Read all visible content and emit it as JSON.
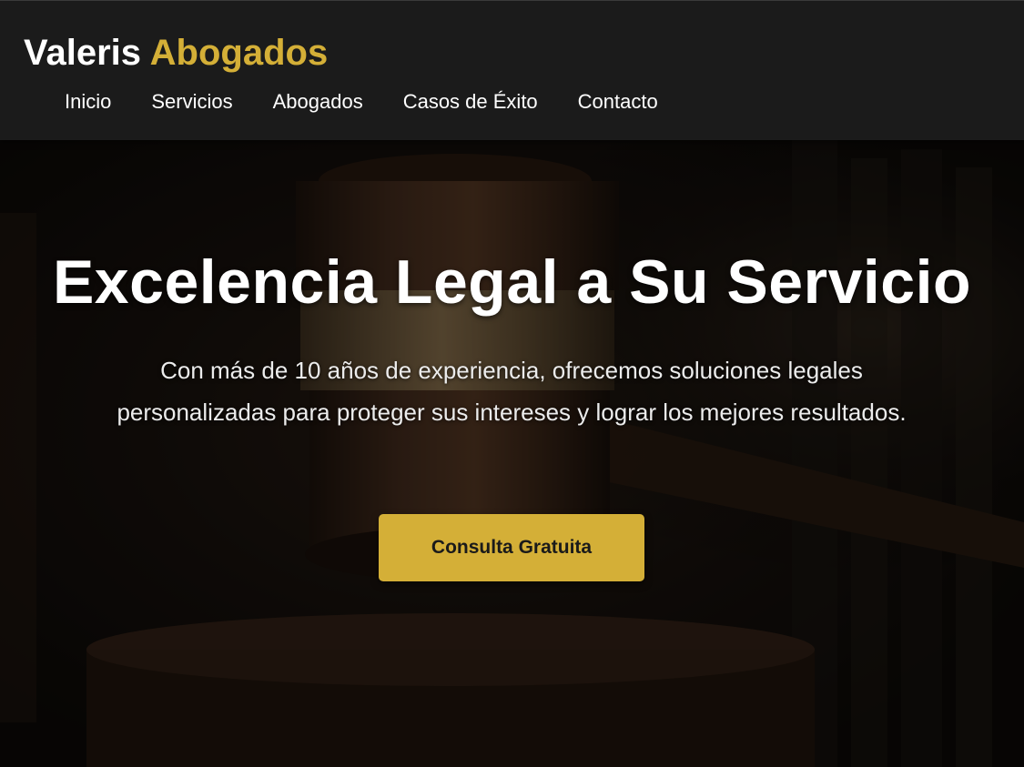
{
  "brand": {
    "name_part1": "Valeris ",
    "name_part2": "Abogados"
  },
  "nav": {
    "items": [
      {
        "label": "Inicio"
      },
      {
        "label": "Servicios"
      },
      {
        "label": "Abogados"
      },
      {
        "label": "Casos de Éxito"
      },
      {
        "label": "Contacto"
      }
    ]
  },
  "hero": {
    "title": "Excelencia Legal a Su Servicio",
    "subtitle": "Con más de 10 años de experiencia, ofrecemos soluciones legales personalizadas para proteger sus intereses y lograr los mejores resultados.",
    "cta_label": "Consulta Gratuita",
    "background_icon": "gavel-icon"
  },
  "colors": {
    "accent": "#d4af37",
    "header_bg": "#1b1b1b",
    "text": "#ffffff"
  }
}
